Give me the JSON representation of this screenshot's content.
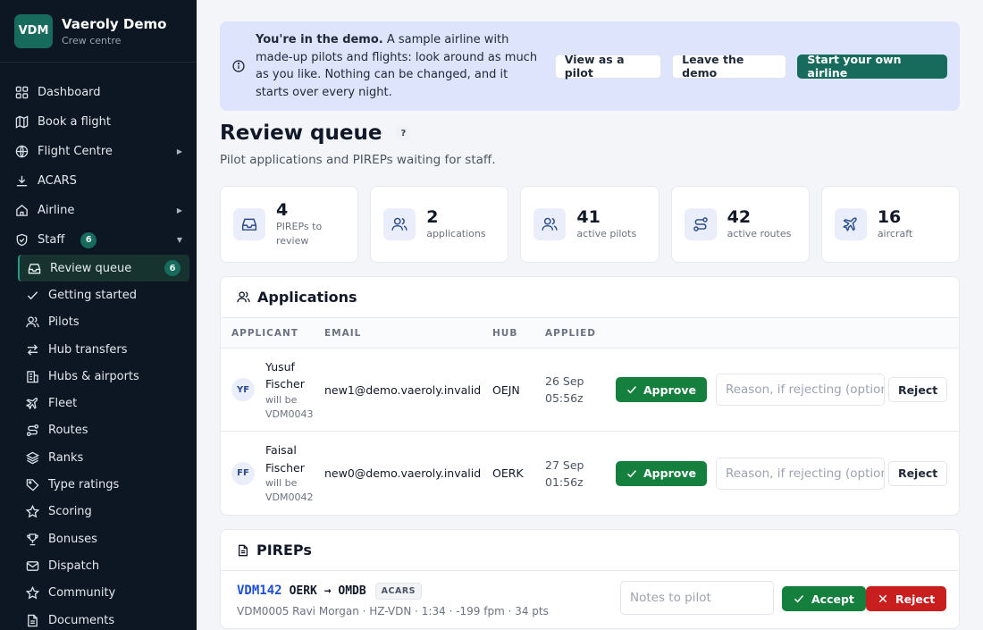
{
  "brand": {
    "logo": "VDM",
    "name": "Vaeroly Demo",
    "subtitle": "Crew centre"
  },
  "nav": {
    "items": [
      {
        "label": "Dashboard",
        "icon": "grid-icon"
      },
      {
        "label": "Book a flight",
        "icon": "map-icon"
      },
      {
        "label": "Flight Centre",
        "icon": "globe-icon"
      },
      {
        "label": "ACARS",
        "icon": "download-icon"
      },
      {
        "label": "Airline",
        "icon": "home-icon"
      },
      {
        "label": "Staff",
        "icon": "shield-icon",
        "badge": "6"
      }
    ],
    "staff_sub": [
      {
        "label": "Review queue",
        "badge": "6"
      },
      {
        "label": "Getting started"
      },
      {
        "label": "Pilots"
      },
      {
        "label": "Hub transfers"
      },
      {
        "label": "Hubs & airports"
      },
      {
        "label": "Fleet"
      },
      {
        "label": "Routes"
      },
      {
        "label": "Ranks"
      },
      {
        "label": "Type ratings"
      },
      {
        "label": "Scoring"
      },
      {
        "label": "Bonuses"
      },
      {
        "label": "Dispatch"
      },
      {
        "label": "Community"
      },
      {
        "label": "Documents"
      }
    ]
  },
  "banner": {
    "bold": "You're in the demo.",
    "text": " A sample airline with made-up pilots and flights: look around as much as you like. Nothing can be changed, and it starts over every night.",
    "view_as_pilot": "View as a pilot",
    "leave_demo": "Leave the demo",
    "start_own": "Start your own airline"
  },
  "page": {
    "title": "Review queue",
    "help": "?",
    "subtitle": "Pilot applications and PIREPs waiting for staff."
  },
  "stats": [
    {
      "value": "4",
      "label": "PIREPs to review"
    },
    {
      "value": "2",
      "label": "applications"
    },
    {
      "value": "41",
      "label": "active pilots"
    },
    {
      "value": "42",
      "label": "active routes"
    },
    {
      "value": "16",
      "label": "aircraft"
    }
  ],
  "applications": {
    "title": "Applications",
    "columns": [
      "APPLICANT",
      "EMAIL",
      "HUB",
      "APPLIED"
    ],
    "approve_label": "Approve",
    "reject_label": "Reject",
    "reason_placeholder": "Reason, if rejecting (optional)",
    "rows": [
      {
        "initials": "YF",
        "first": "Yusuf",
        "last": "Fischer",
        "will_be": "will be",
        "callsign": "VDM0043",
        "email": "new1@demo.vaeroly.invalid",
        "hub": "OEJN",
        "applied_date": "26 Sep",
        "applied_time": "05:56z"
      },
      {
        "initials": "FF",
        "first": "Faisal",
        "last": "Fischer",
        "will_be": "will be",
        "callsign": "VDM0042",
        "email": "new0@demo.vaeroly.invalid",
        "hub": "OERK",
        "applied_date": "27 Sep",
        "applied_time": "01:56z"
      }
    ]
  },
  "pireps": {
    "title": "PIREPs",
    "notes_placeholder": "Notes to pilot",
    "accept_label": "Accept",
    "reject_label": "Reject",
    "rows": [
      {
        "flight": "VDM142",
        "route": "OERK → OMDB",
        "tag": "ACARS",
        "meta": "VDM0005 Ravi Morgan · HZ-VDN · 1:34 · -199 fpm · 34 pts"
      }
    ]
  }
}
